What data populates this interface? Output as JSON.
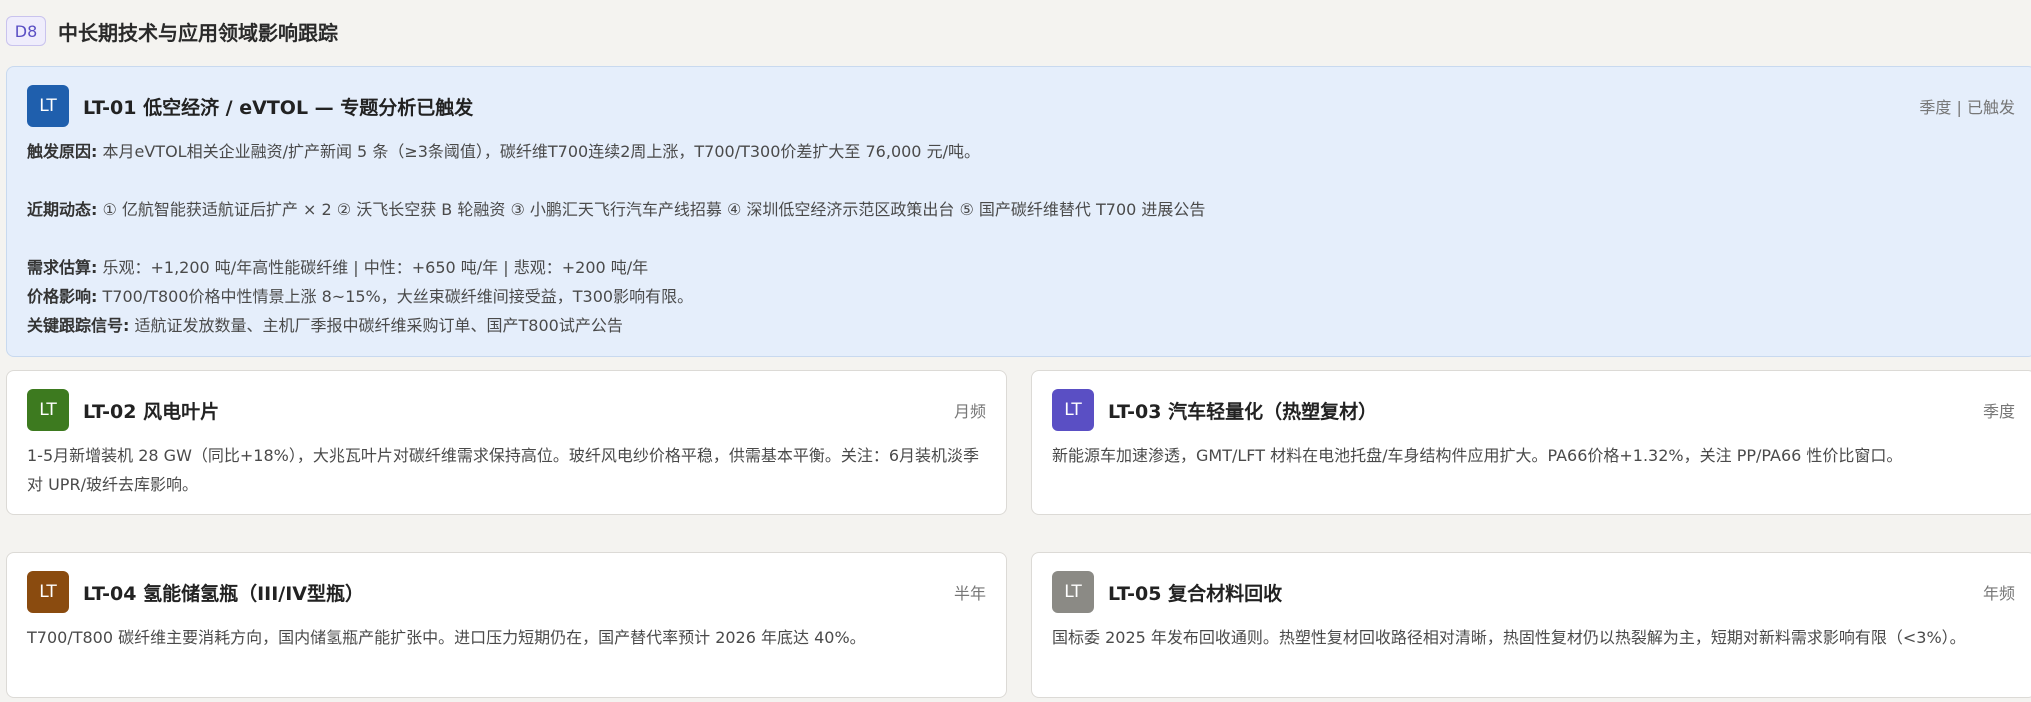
{
  "section": {
    "badge": "D8",
    "title": "中长期技术与应用领域影响跟踪"
  },
  "cards": {
    "lt01": {
      "icon": "LT",
      "icon_color": "#1f5fad",
      "title": "LT-01 低空经济 / eVTOL — 专题分析已触发",
      "tag": "季度 | 已触发",
      "trigger_key": "触发原因:",
      "trigger_val": "本月eVTOL相关企业融资/扩产新闻 5 条（≥3条阈值），碳纤维T700连续2周上涨，T700/T300价差扩大至 76,000 元/吨。",
      "recent_key": "近期动态:",
      "recent_val": "① 亿航智能获适航证后扩产 × 2 ② 沃飞长空获 B 轮融资 ③ 小鹏汇天飞行汽车产线招募 ④ 深圳低空经济示范区政策出台 ⑤ 国产碳纤维替代 T700 进展公告",
      "demand_key": "需求估算:",
      "demand_val": "乐观：+1,200 吨/年高性能碳纤维 | 中性：+650 吨/年 | 悲观：+200 吨/年",
      "price_key": "价格影响:",
      "price_val": "T700/T800价格中性情景上涨 8~15%，大丝束碳纤维间接受益，T300影响有限。",
      "signal_key": "关键跟踪信号:",
      "signal_val": "适航证发放数量、主机厂季报中碳纤维采购订单、国产T800试产公告"
    },
    "lt02": {
      "icon": "LT",
      "icon_color": "#3d7a1f",
      "title": "LT-02 风电叶片",
      "tag": "月频",
      "body": "1-5月新增装机 28 GW（同比+18%），大兆瓦叶片对碳纤维需求保持高位。玻纤风电纱价格平稳，供需基本平衡。关注：6月装机淡季对 UPR/玻纤去库影响。"
    },
    "lt03": {
      "icon": "LT",
      "icon_color": "#5a4fc4",
      "title": "LT-03 汽车轻量化（热塑复材）",
      "tag": "季度",
      "body": "新能源车加速渗透，GMT/LFT 材料在电池托盘/车身结构件应用扩大。PA66价格+1.32%，关注 PP/PA66 性价比窗口。"
    },
    "lt04": {
      "icon": "LT",
      "icon_color": "#8a4b0f",
      "title": "LT-04 氢能储氢瓶（III/IV型瓶）",
      "tag": "半年",
      "body": "T700/T800 碳纤维主要消耗方向，国内储氢瓶产能扩张中。进口压力短期仍在，国产替代率预计 2026 年底达 40%。"
    },
    "lt05": {
      "icon": "LT",
      "icon_color": "#8b8a85",
      "title": "LT-05 复合材料回收",
      "tag": "年频",
      "body": "国标委 2025 年发布回收通则。热塑性复材回收路径相对清晰，热固性复材仍以热裂解为主，短期对新料需求影响有限（<3%）。"
    }
  }
}
